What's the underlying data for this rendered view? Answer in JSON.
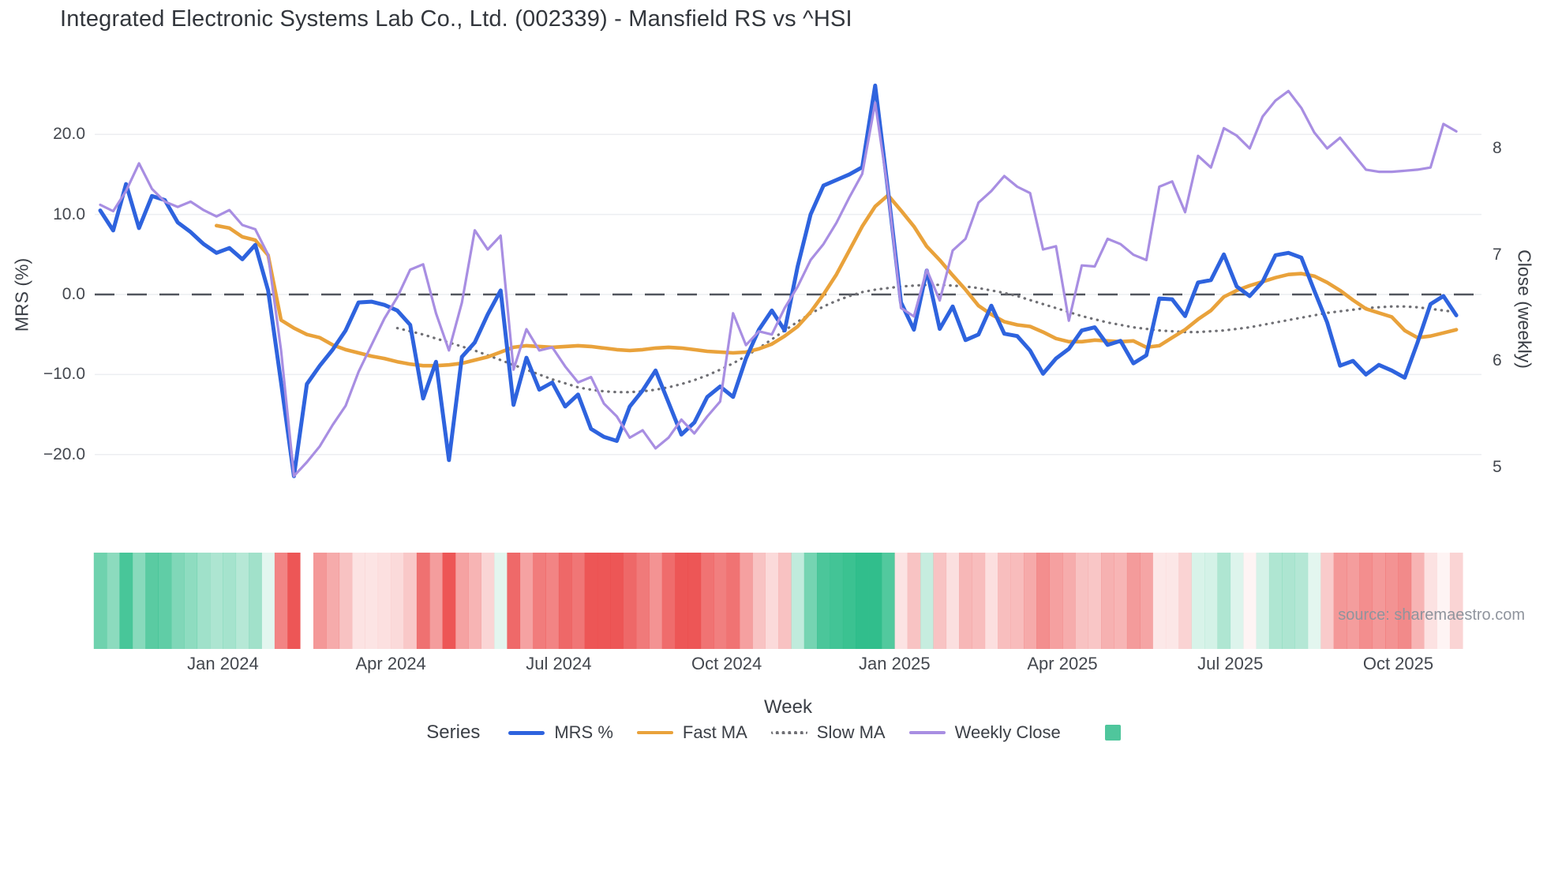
{
  "title": "Integrated Electronic Systems Lab Co., Ltd. (002339) - Mansfield RS vs ^HSI",
  "source_note": "source: sharemaestro.com",
  "axes": {
    "left": {
      "title": "MRS (%)",
      "ticks": [
        "20.0",
        "10.0",
        "0.0",
        "−10.0",
        "−20.0"
      ],
      "tick_values": [
        20,
        10,
        0,
        -10,
        -20
      ]
    },
    "right": {
      "title": "Close (weekly)",
      "ticks": [
        "8",
        "7",
        "6",
        "5"
      ],
      "tick_values": [
        8,
        7,
        6,
        5
      ]
    },
    "x": {
      "title": "Week",
      "ticks": [
        {
          "label": "Jan 2024",
          "week": 9.5
        },
        {
          "label": "Apr 2024",
          "week": 22.5
        },
        {
          "label": "Jul 2024",
          "week": 35.5
        },
        {
          "label": "Oct 2024",
          "week": 48.5
        },
        {
          "label": "Jan 2025",
          "week": 61.5
        },
        {
          "label": "Apr 2025",
          "week": 74.5
        },
        {
          "label": "Jul 2025",
          "week": 87.5
        },
        {
          "label": "Oct 2025",
          "week": 100.5
        }
      ]
    }
  },
  "legend": {
    "series_label": "Series",
    "entries": [
      {
        "label": "MRS %",
        "color": "#2e63de",
        "style": "solid-thick"
      },
      {
        "label": "Fast MA",
        "color": "#e9a23b",
        "style": "solid-mid"
      },
      {
        "label": "Slow MA",
        "color": "#6f6f74",
        "style": "dotted"
      },
      {
        "label": "Weekly Close",
        "color": "#a88ee2",
        "style": "solid-mid"
      }
    ],
    "heat_swatch_color": "#4fc69c"
  },
  "colors": {
    "mrs": "#2e63de",
    "fast_ma": "#e9a23b",
    "slow_ma": "#6f6f74",
    "weekly_close": "#a88ee2",
    "zero_line": "#51555d",
    "gridline": "#eceef1",
    "heat_positive": "32,185,130",
    "heat_negative": "235,72,72"
  },
  "chart_data": {
    "type": "line",
    "x_unit": "week_index",
    "n_weeks": 106,
    "left_axis_range_labels": [
      20,
      10,
      0,
      -10,
      -20
    ],
    "right_axis_range_labels": [
      8,
      7,
      6,
      5
    ],
    "grid": true,
    "legend_position": "bottom",
    "series": [
      {
        "name": "MRS %",
        "axis": "left",
        "values": [
          10.5,
          8.0,
          13.8,
          8.3,
          12.3,
          11.8,
          9.0,
          7.8,
          6.3,
          5.2,
          5.8,
          4.4,
          6.2,
          0.5,
          -11.0,
          -22.7,
          -11.2,
          -8.9,
          -6.9,
          -4.5,
          -1.0,
          -0.9,
          -1.3,
          -2.0,
          -3.8,
          -13.0,
          -8.4,
          -20.7,
          -7.8,
          -6.0,
          -2.5,
          0.5,
          -13.8,
          -7.9,
          -11.9,
          -11.0,
          -14.0,
          -12.5,
          -16.8,
          -17.8,
          -18.3,
          -14.0,
          -12.0,
          -9.5,
          -13.5,
          -17.5,
          -16.0,
          -12.8,
          -11.5,
          -12.8,
          -8.0,
          -4.4,
          -2.0,
          -4.5,
          3.5,
          10.0,
          13.6,
          14.3,
          15.0,
          15.9,
          26.1,
          13.0,
          -1.0,
          -4.4,
          3.0,
          -4.3,
          -1.5,
          -5.7,
          -5.0,
          -1.4,
          -4.9,
          -5.2,
          -7.0,
          -9.9,
          -8.0,
          -6.8,
          -4.5,
          -4.1,
          -6.3,
          -5.8,
          -8.6,
          -7.6,
          -0.5,
          -0.6,
          -2.7,
          1.5,
          1.8,
          5.0,
          1.0,
          -0.2,
          1.6,
          4.9,
          5.2,
          4.6,
          0.5,
          -3.5,
          -8.9,
          -8.3,
          -10.0,
          -8.8,
          -9.5,
          -10.4,
          -6.0,
          -1.2,
          -0.2,
          -2.6
        ]
      },
      {
        "name": "Fast MA",
        "axis": "left",
        "values": [
          null,
          null,
          null,
          null,
          null,
          null,
          null,
          null,
          null,
          8.6,
          8.3,
          7.2,
          6.8,
          4.9,
          -3.2,
          -4.2,
          -5.0,
          -5.4,
          -6.3,
          -6.9,
          -7.3,
          -7.7,
          -8.0,
          -8.4,
          -8.7,
          -8.9,
          -8.9,
          -8.8,
          -8.6,
          -8.2,
          -7.8,
          -7.2,
          -6.6,
          -6.4,
          -6.5,
          -6.6,
          -6.5,
          -6.4,
          -6.5,
          -6.7,
          -6.9,
          -7.0,
          -6.9,
          -6.7,
          -6.6,
          -6.7,
          -6.9,
          -7.1,
          -7.2,
          -7.3,
          -7.2,
          -6.8,
          -6.2,
          -5.2,
          -4.0,
          -2.2,
          0.0,
          2.5,
          5.5,
          8.5,
          11.0,
          12.4,
          10.5,
          8.5,
          6.0,
          4.3,
          2.4,
          0.6,
          -1.4,
          -2.5,
          -3.4,
          -3.8,
          -4.0,
          -4.7,
          -5.5,
          -5.9,
          -5.9,
          -5.7,
          -5.8,
          -5.9,
          -5.8,
          -6.6,
          -6.4,
          -5.4,
          -4.4,
          -3.1,
          -2.0,
          -0.3,
          0.5,
          1.1,
          1.6,
          2.1,
          2.5,
          2.6,
          2.3,
          1.5,
          0.5,
          -0.7,
          -1.8,
          -2.3,
          -2.8,
          -4.5,
          -5.4,
          -5.2,
          -4.8,
          -4.4
        ]
      },
      {
        "name": "Slow MA",
        "axis": "left",
        "values": [
          null,
          null,
          null,
          null,
          null,
          null,
          null,
          null,
          null,
          null,
          null,
          null,
          null,
          null,
          null,
          null,
          null,
          null,
          null,
          null,
          null,
          null,
          null,
          -4.2,
          -4.6,
          -5.0,
          -5.5,
          -6.0,
          -6.5,
          -7.0,
          -7.6,
          -8.2,
          -8.8,
          -9.4,
          -10.0,
          -10.6,
          -11.1,
          -11.6,
          -11.9,
          -12.1,
          -12.2,
          -12.2,
          -12.1,
          -11.9,
          -11.6,
          -11.2,
          -10.7,
          -10.1,
          -9.4,
          -8.6,
          -7.7,
          -6.7,
          -5.6,
          -4.5,
          -3.4,
          -2.4,
          -1.5,
          -0.8,
          -0.2,
          0.3,
          0.6,
          0.8,
          1.0,
          1.1,
          1.2,
          1.2,
          1.1,
          1.0,
          0.8,
          0.5,
          0.2,
          -0.2,
          -0.7,
          -1.2,
          -1.7,
          -2.2,
          -2.7,
          -3.1,
          -3.5,
          -3.8,
          -4.1,
          -4.3,
          -4.5,
          -4.6,
          -4.7,
          -4.7,
          -4.6,
          -4.5,
          -4.3,
          -4.1,
          -3.8,
          -3.5,
          -3.2,
          -2.9,
          -2.6,
          -2.3,
          -2.1,
          -1.9,
          -1.7,
          -1.6,
          -1.5,
          -1.5,
          -1.6,
          -1.8,
          -2.0,
          -2.2
        ]
      },
      {
        "name": "Weekly Close",
        "axis": "right",
        "values": [
          7.47,
          7.41,
          7.6,
          7.86,
          7.62,
          7.5,
          7.45,
          7.5,
          7.42,
          7.36,
          7.42,
          7.28,
          7.24,
          7.0,
          6.1,
          4.92,
          5.05,
          5.2,
          5.4,
          5.58,
          5.9,
          6.15,
          6.4,
          6.6,
          6.86,
          6.91,
          6.45,
          6.1,
          6.55,
          7.23,
          7.05,
          7.18,
          5.92,
          6.3,
          6.1,
          6.13,
          5.95,
          5.8,
          5.85,
          5.6,
          5.48,
          5.28,
          5.35,
          5.18,
          5.28,
          5.45,
          5.32,
          5.48,
          5.62,
          6.45,
          6.15,
          6.28,
          6.25,
          6.5,
          6.7,
          6.95,
          7.1,
          7.3,
          7.54,
          7.76,
          8.43,
          7.6,
          6.5,
          6.42,
          6.86,
          6.57,
          7.04,
          7.15,
          7.49,
          7.6,
          7.74,
          7.64,
          7.58,
          7.05,
          7.08,
          6.38,
          6.9,
          6.89,
          7.15,
          7.1,
          7.0,
          6.95,
          7.64,
          7.69,
          7.4,
          7.93,
          7.82,
          8.19,
          8.12,
          8.0,
          8.3,
          8.45,
          8.54,
          8.38,
          8.15,
          8.0,
          8.1,
          7.95,
          7.8,
          7.78,
          7.78,
          7.79,
          7.8,
          7.82,
          8.23,
          8.16
        ]
      }
    ],
    "heatmap": {
      "description": "weekly strip colored by MRS % sign and magnitude (green positive, red negative)",
      "source_values": "MRS %",
      "gap_weeks": [
        16
      ]
    }
  }
}
